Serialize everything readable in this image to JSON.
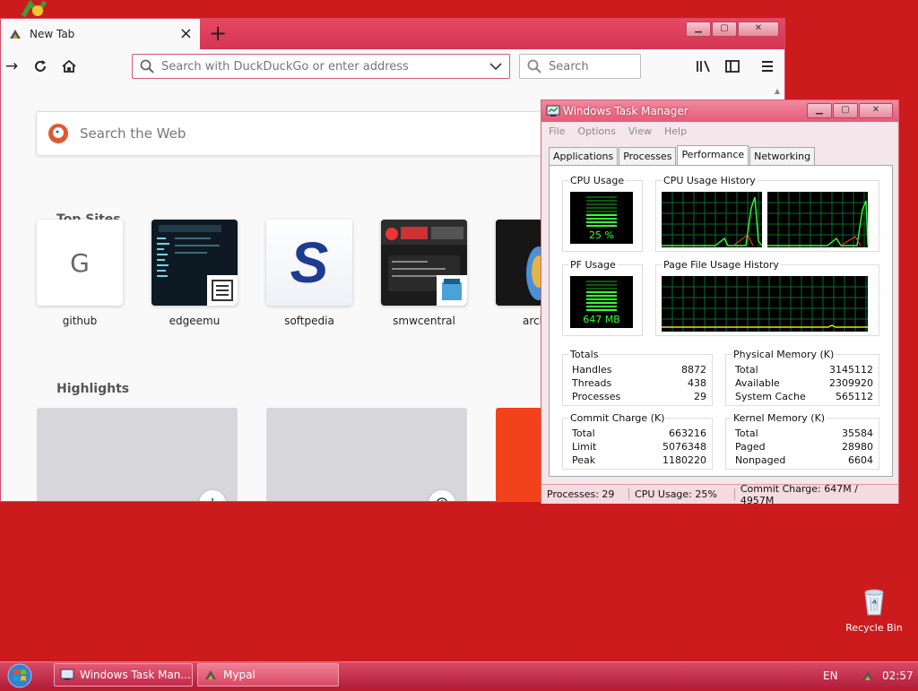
{
  "firefox": {
    "tab_title": "New Tab",
    "tab_close": "×",
    "new_tab": "+",
    "url_placeholder": "Search with DuckDuckGo or enter address",
    "search_placeholder": "Search",
    "web_search_placeholder": "Search the Web",
    "top_sites_title": "Top Sites",
    "top_sites": [
      {
        "label": "github",
        "letter": "G"
      },
      {
        "label": "edgeemu"
      },
      {
        "label": "softpedia",
        "letter": "S"
      },
      {
        "label": "smwcentral"
      },
      {
        "label": "arch"
      }
    ],
    "highlights_title": "Highlights"
  },
  "taskmgr": {
    "title": "Windows Task Manager",
    "menu": [
      "File",
      "Options",
      "View",
      "Help"
    ],
    "tabs": [
      "Applications",
      "Processes",
      "Performance",
      "Networking"
    ],
    "active_tab": "Performance",
    "cpu_usage_label": "CPU Usage",
    "cpu_usage_value": "25 %",
    "cpu_history_label": "CPU Usage History",
    "pf_usage_label": "PF Usage",
    "pf_usage_value": "647 MB",
    "pf_history_label": "Page File Usage History",
    "totals": {
      "title": "Totals",
      "rows": [
        {
          "k": "Handles",
          "v": "8872"
        },
        {
          "k": "Threads",
          "v": "438"
        },
        {
          "k": "Processes",
          "v": "29"
        }
      ]
    },
    "physical": {
      "title": "Physical Memory (K)",
      "rows": [
        {
          "k": "Total",
          "v": "3145112"
        },
        {
          "k": "Available",
          "v": "2309920"
        },
        {
          "k": "System Cache",
          "v": "565112"
        }
      ]
    },
    "commit": {
      "title": "Commit Charge (K)",
      "rows": [
        {
          "k": "Total",
          "v": "663216"
        },
        {
          "k": "Limit",
          "v": "5076348"
        },
        {
          "k": "Peak",
          "v": "1180220"
        }
      ]
    },
    "kernel": {
      "title": "Kernel Memory (K)",
      "rows": [
        {
          "k": "Total",
          "v": "35584"
        },
        {
          "k": "Paged",
          "v": "28980"
        },
        {
          "k": "Nonpaged",
          "v": "6604"
        }
      ]
    },
    "status": {
      "processes": "Processes: 29",
      "cpu": "CPU Usage: 25%",
      "commit": "Commit Charge: 647M / 4957M"
    }
  },
  "taskbar": {
    "items": [
      "Windows Task Man...",
      "Mypal"
    ],
    "lang": "EN",
    "clock": "02:57"
  },
  "desktop": {
    "recycle_bin": "Recycle Bin"
  },
  "colors": {
    "desktop": "#cc1b1d",
    "accent": "#e55a78",
    "meter_green": "#33ff33"
  }
}
